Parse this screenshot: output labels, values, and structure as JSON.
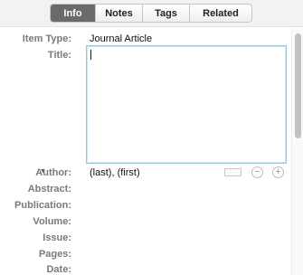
{
  "tabs": [
    {
      "label": "Info",
      "active": true
    },
    {
      "label": "Notes",
      "active": false
    },
    {
      "label": "Tags",
      "active": false
    },
    {
      "label": "Related",
      "active": false
    }
  ],
  "fields": {
    "item_type": {
      "label": "Item Type:",
      "value": "Journal Article"
    },
    "title": {
      "label": "Title:",
      "value": ""
    },
    "author": {
      "label": "Author:",
      "last_placeholder": "(last)",
      "separator": ",",
      "first_placeholder": "(first)"
    },
    "abstract": {
      "label": "Abstract:"
    },
    "publication": {
      "label": "Publication:"
    },
    "volume": {
      "label": "Volume:"
    },
    "issue": {
      "label": "Issue:"
    },
    "pages": {
      "label": "Pages:"
    },
    "date": {
      "label": "Date:"
    }
  },
  "icons": {
    "author_toggle": "triangle-down-icon",
    "remove_creator": "minus-circle-icon",
    "add_creator": "plus-circle-icon"
  },
  "colors": {
    "active_tab_bg": "#6a6a6a",
    "label_text": "#7a7a7a",
    "focus_border": "#9fc9d9"
  }
}
